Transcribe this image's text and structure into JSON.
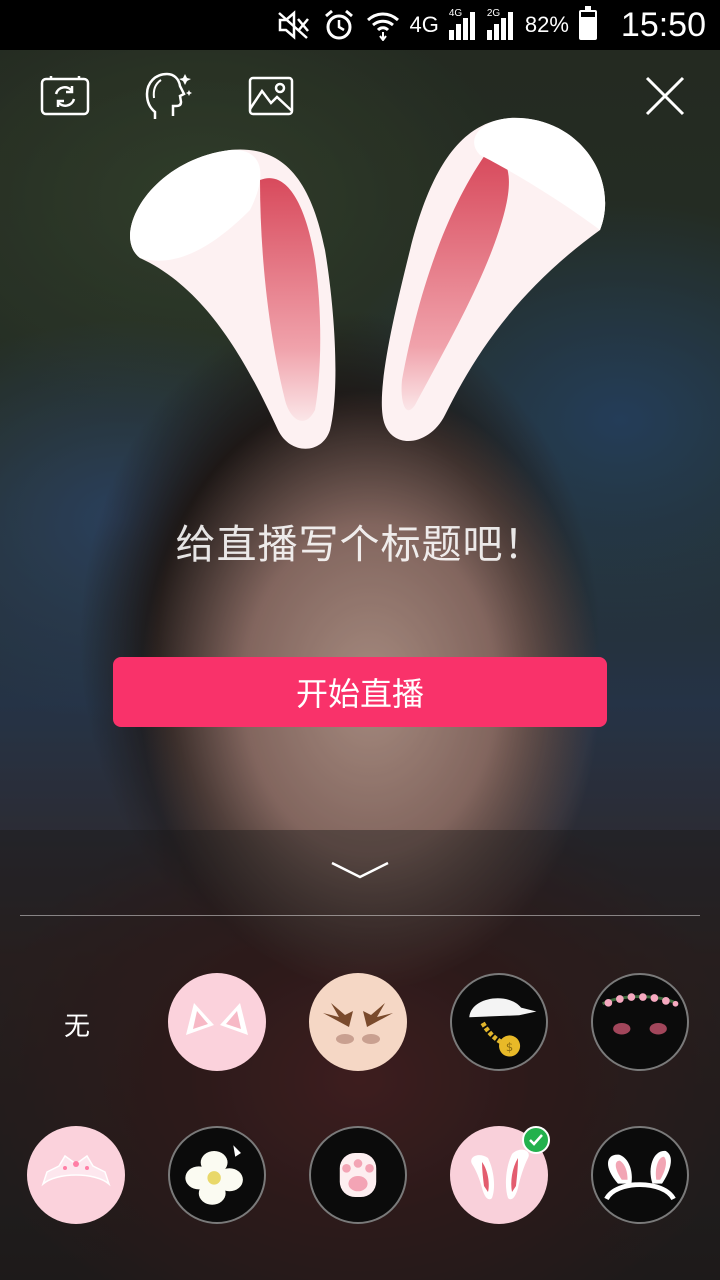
{
  "status_bar": {
    "network_1": "4G",
    "network_2": "4G",
    "network_3": "2G",
    "battery": "82%",
    "battery_level": 0.82,
    "time": "15:50",
    "icons": [
      "mute-icon",
      "alarm-icon",
      "wifi-icon",
      "signal-icon",
      "battery-icon"
    ]
  },
  "toolbar": {
    "icons": [
      "flip-camera-icon",
      "beauty-face-icon",
      "gallery-icon",
      "close-icon"
    ]
  },
  "main": {
    "title_prompt": "给直播写个标题吧！",
    "start_button": "开始直播"
  },
  "sticker_panel": {
    "none_label": "无",
    "selected_sticker": "bunny-ears",
    "stickers": [
      "cat-ears",
      "deer-antlers",
      "gold-chain-cap",
      "flower-crown",
      "tiara",
      "white-flower",
      "cat-paw",
      "bunny-ears",
      "bunny-headband"
    ]
  },
  "colors": {
    "accent": "#f9326a",
    "check_green": "#23b14d",
    "ear_inner": "#e35d6f"
  }
}
